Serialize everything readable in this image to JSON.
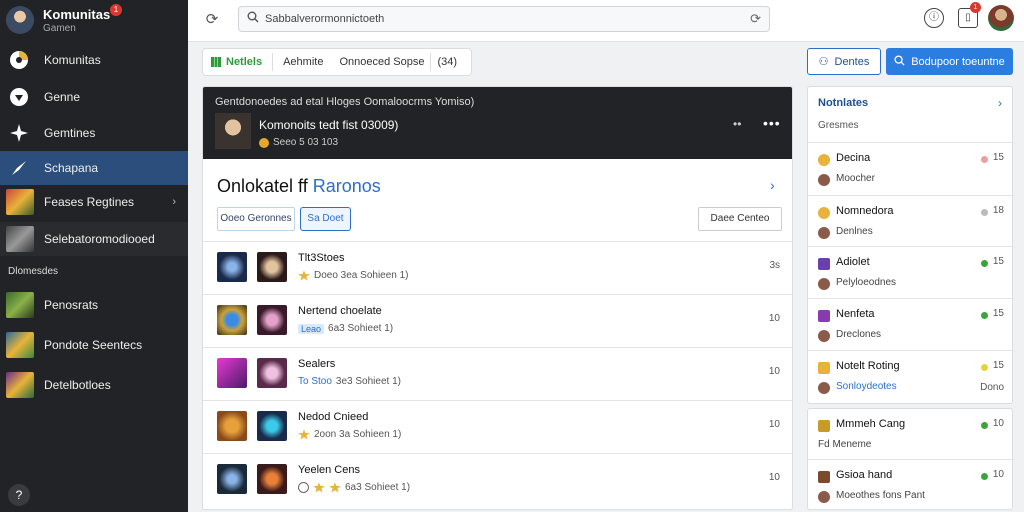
{
  "sidebar": {
    "profile": {
      "name": "Komunitas",
      "sub": "Gamen",
      "badge": "1"
    },
    "items": [
      {
        "label": "Komunitas"
      },
      {
        "label": "Genne"
      },
      {
        "label": "Gemtines"
      },
      {
        "label": "Schapana"
      },
      {
        "label": "Feases Regtines"
      },
      {
        "label": "Selebatoromodiooed"
      }
    ],
    "section": "Dlomesdes",
    "games": [
      {
        "label": "Penosrats"
      },
      {
        "label": "Pondote Seentecs"
      },
      {
        "label": "Detelbotloes"
      }
    ],
    "help_glyph": "?"
  },
  "topbar": {
    "search_placeholder": "Sabbalverormonnictoeth",
    "notif_badge": "1"
  },
  "filters": {
    "active": "Netlels",
    "second": "Aehmite",
    "third": "Onnoeced Sopse",
    "count": "(34)"
  },
  "actions": {
    "outline_label": "Dentes",
    "primary_label": "Bodupoor toeuntne"
  },
  "featured": {
    "top": "Gentdonoedes ad etal Hloges Oomaloocrms Yomiso)",
    "title": "Komonoits tedt fist 03009)",
    "meta": "Seeo 5 03 103"
  },
  "section": {
    "title_a": "Onlokatel ff",
    "title_b": "Raronos",
    "chip1": "Ooeo Geronnes",
    "chip2": "Sa Doet",
    "chip3": "Daee Centeo"
  },
  "rows": [
    {
      "name": "Tlt3Stoes",
      "meta": "Doeo 3ea Sohieen 1)",
      "count": "3s",
      "style": "star"
    },
    {
      "name": "Nertend choelate",
      "tag": "Leao",
      "meta": "6a3 Sohieet 1)",
      "count": "10",
      "style": "tag"
    },
    {
      "name": "Sealers",
      "tag": "To Stoo",
      "meta": "3e3 Sohieet 1)",
      "count": "10",
      "style": "tag2"
    },
    {
      "name": "Nedod Cnieed",
      "meta": "2oon 3a Sohieen 1)",
      "count": "10",
      "style": "star"
    },
    {
      "name": "Yeelen Cens",
      "meta": "6a3 Sohieet 1)",
      "count": "10",
      "style": "circ"
    }
  ],
  "right_panel": {
    "header": "Notnlates",
    "sub": "Gresmes",
    "items": [
      {
        "a": "Decina",
        "b": "Moocher",
        "n": "15",
        "color": "#e8b33a",
        "dot": "#e8a0a0",
        "b_color": "#444"
      },
      {
        "a": "Nomnedora",
        "b": "Denlnes",
        "n": "18",
        "color": "#e8b33a",
        "dot": "#bbbbbb",
        "b_color": "#444"
      },
      {
        "a": "Adiolet",
        "b": "Pelyloeodnes",
        "n": "15",
        "color": "#6b3fb0",
        "dot": "#3aa53a",
        "b_color": "#444"
      },
      {
        "a": "Nenfeta",
        "b": "Dreclones",
        "n": "15",
        "color": "#8a3ab0",
        "dot": "#3aa53a",
        "b_color": "#444"
      },
      {
        "a": "Notelt Roting",
        "b": "Sonloydeotes",
        "n": "15",
        "n2": "Dono",
        "color": "#e8b33a",
        "dot": "#e8d23a",
        "b_color": "#2b6fcc"
      }
    ],
    "items2": [
      {
        "a": "Mmmeh Cang",
        "b": "Fd Meneme",
        "n": "10",
        "color": "#c79a2a",
        "dot": "#3aa53a",
        "b_color": "#444",
        "b_prefix": true
      },
      {
        "a": "Gsioa hand",
        "b": "Moeothes fons Pant",
        "n": "10",
        "color": "#7a4a2a",
        "dot": "#3aa53a",
        "b_color": "#444",
        "a_accent": true
      }
    ]
  }
}
